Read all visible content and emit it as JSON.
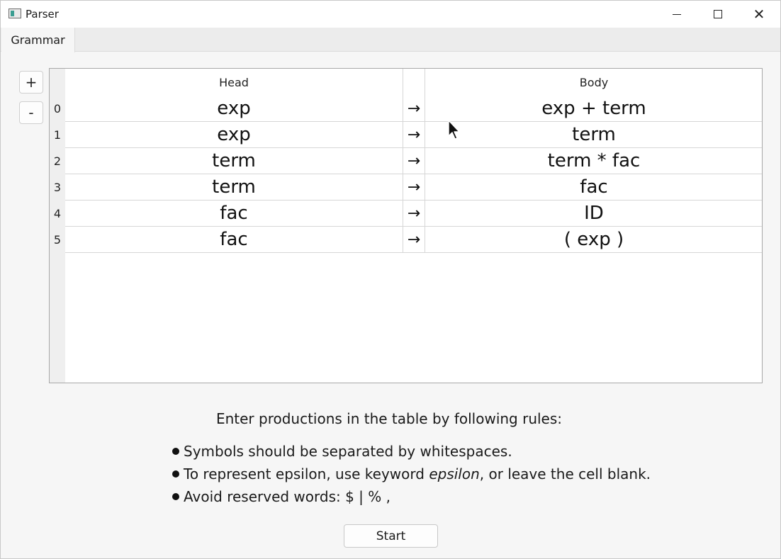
{
  "window": {
    "title": "Parser",
    "controls": {
      "minimize": "minimize-icon",
      "maximize": "maximize-icon",
      "close": "close-icon"
    }
  },
  "tabs": [
    {
      "label": "Grammar",
      "active": true
    }
  ],
  "side_buttons": {
    "add_label": "+",
    "remove_label": "-"
  },
  "table": {
    "headers": {
      "head": "Head",
      "arrow": "",
      "body": "Body"
    },
    "rows": [
      {
        "index": "0",
        "head": "exp",
        "arrow": "→",
        "body": "exp + term"
      },
      {
        "index": "1",
        "head": "exp",
        "arrow": "→",
        "body": "term"
      },
      {
        "index": "2",
        "head": "term",
        "arrow": "→",
        "body": "term * fac"
      },
      {
        "index": "3",
        "head": "term",
        "arrow": "→",
        "body": "fac"
      },
      {
        "index": "4",
        "head": "fac",
        "arrow": "→",
        "body": "ID"
      },
      {
        "index": "5",
        "head": "fac",
        "arrow": "→",
        "body": "( exp )"
      }
    ]
  },
  "instructions": {
    "title": "Enter productions in the table by following rules:",
    "rule1": "Symbols should be separated by whitespaces.",
    "rule2_prefix": "To represent epsilon, use keyword ",
    "rule2_keyword": "epsilon",
    "rule2_suffix": ", or leave the cell blank.",
    "rule3": "Avoid reserved words: $ | % ,"
  },
  "start_button": {
    "label": "Start"
  },
  "colors": {
    "accent_icon": "#3b9e92",
    "background": "#f6f6f6",
    "table_bg": "#ffffff"
  }
}
